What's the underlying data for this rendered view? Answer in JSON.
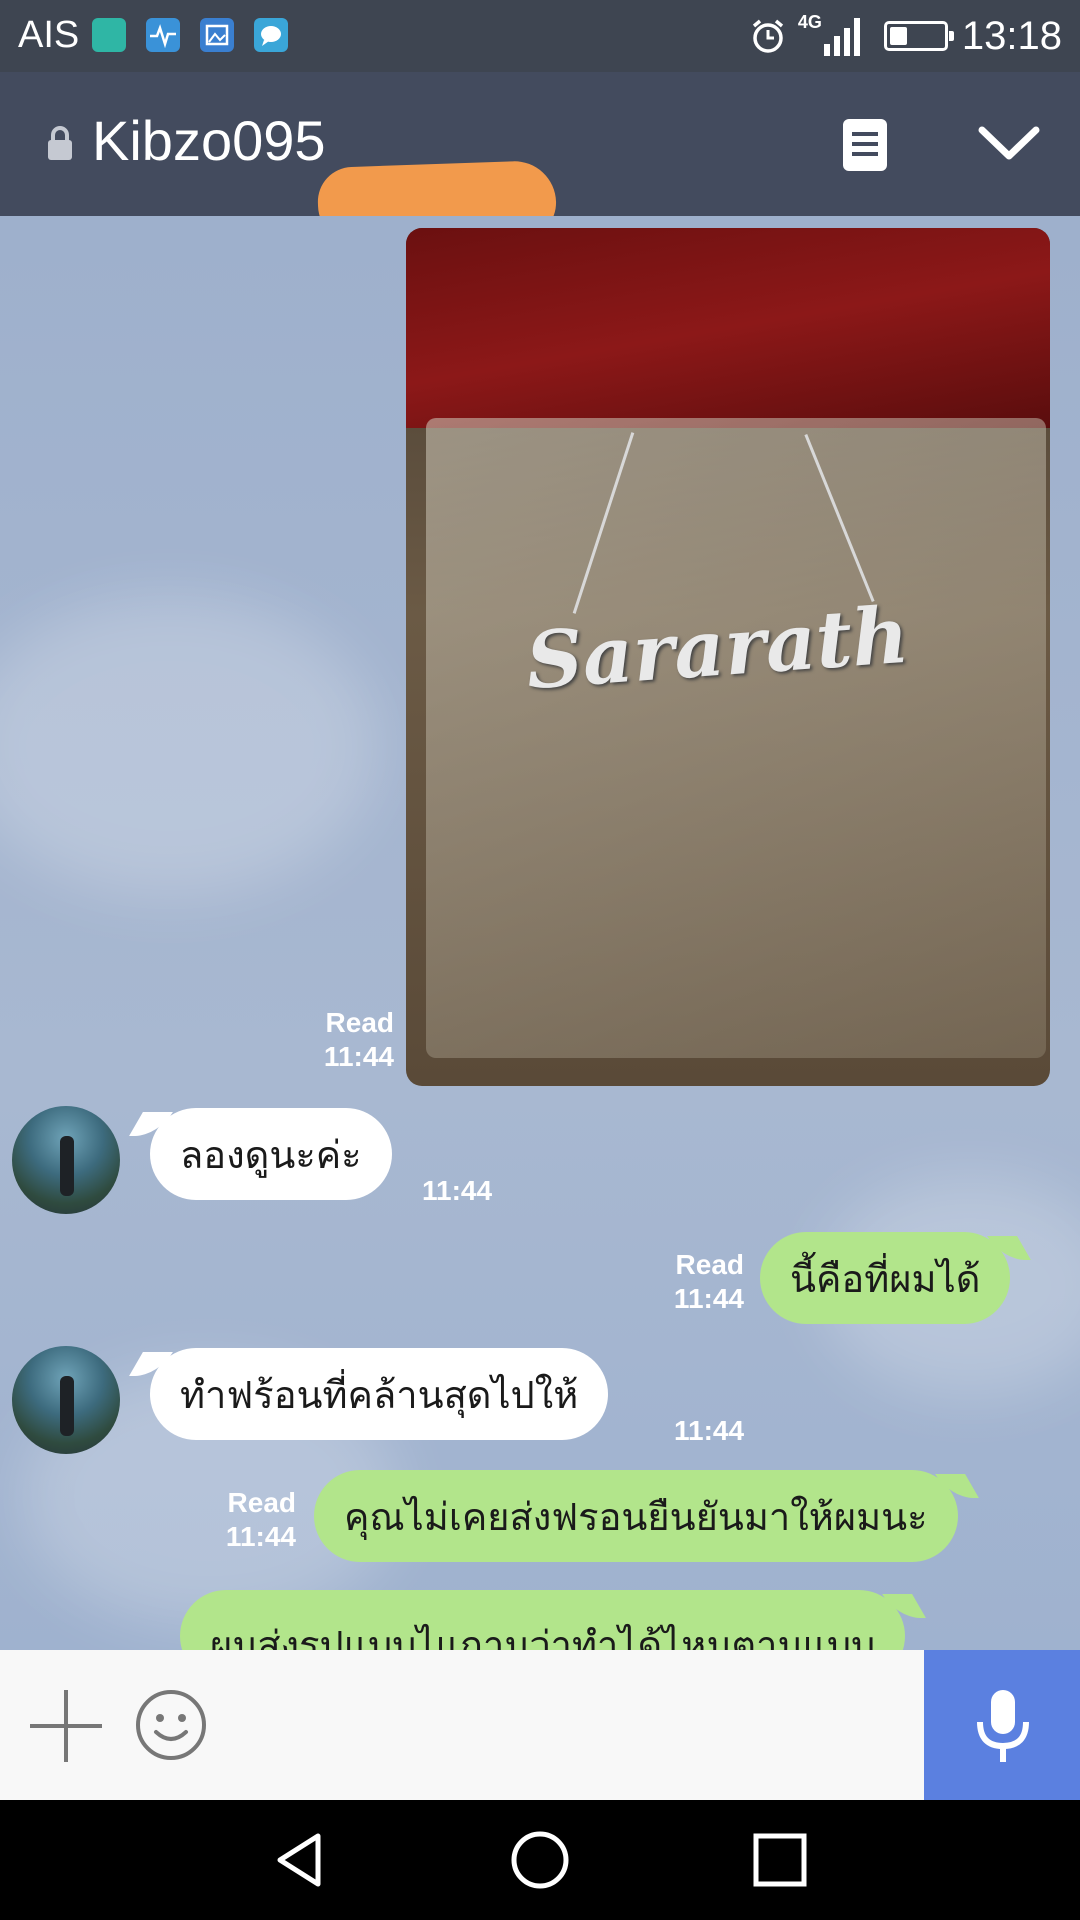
{
  "status_bar": {
    "carrier": "AIS",
    "network": "4G",
    "time": "13:18",
    "battery_level": 0.3,
    "app_icons": [
      "line-app-icon",
      "health-app-icon",
      "gallery-app-icon",
      "message-app-icon"
    ]
  },
  "header": {
    "title": "Kibzo095",
    "menu_icon": "notes-icon",
    "collapse_icon": "chevron-down-icon"
  },
  "messages": [
    {
      "type": "image",
      "direction": "out",
      "read_label": "Read",
      "time": "11:44",
      "image_text": "Sararath"
    },
    {
      "type": "text",
      "direction": "in",
      "text": "ลองดูนะค่ะ",
      "time": "11:44"
    },
    {
      "type": "text",
      "direction": "out",
      "read_label": "Read",
      "text": "นี้คือที่ผมได้",
      "time": "11:44"
    },
    {
      "type": "text",
      "direction": "in",
      "text": "ทำฟร้อนที่คล้านสุดไปให้",
      "time": "11:44"
    },
    {
      "type": "text",
      "direction": "out",
      "read_label": "Read",
      "text": "คุณไม่เคยส่งฟรอนยืนยันมาให้ผมนะ",
      "time": "11:44"
    },
    {
      "type": "text",
      "direction": "out",
      "text": "ผมส่งรปแบบไแถามว่าทำได้ไหมตามแบบ"
    }
  ],
  "input_bar": {
    "add_icon": "plus-icon",
    "emoji_icon": "smiley-icon",
    "mic_icon": "microphone-icon",
    "mic_color": "#5b80e0"
  },
  "colors": {
    "outgoing_bubble": "#b2e58b",
    "incoming_bubble": "#ffffff",
    "header_bg": "#434b5e",
    "redaction": "#f29a4c"
  }
}
